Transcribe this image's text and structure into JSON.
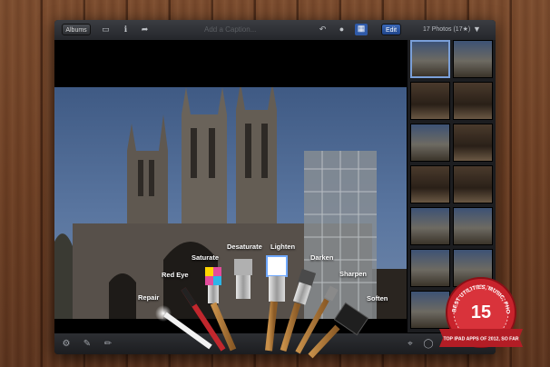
{
  "topbar": {
    "albums_label": "Albums",
    "caption_placeholder": "Add a Caption...",
    "edit_label": "Edit",
    "photo_count": "17 Photos (17★)"
  },
  "brushes": [
    {
      "label": "Repair",
      "color": "#ffffff"
    },
    {
      "label": "Red Eye",
      "color": "#c1272d"
    },
    {
      "label": "Saturate",
      "color": "#e24c9c"
    },
    {
      "label": "Desaturate",
      "color": "#b0b0b0"
    },
    {
      "label": "Lighten",
      "color": "#6fa8ff"
    },
    {
      "label": "Darken",
      "color": "#4a4a4a"
    },
    {
      "label": "Sharpen",
      "color": "#8a8a8a"
    },
    {
      "label": "Soften",
      "color": "#222222"
    }
  ],
  "badge": {
    "number": "15",
    "arc_text": "BEST UTILITIES, MUSIC, PHOTOS",
    "ribbon_text": "TOP IPAD APPS OF 2012, SO FAR"
  },
  "icons": {
    "bottom_left": [
      "gear-icon",
      "eraser-icon",
      "brush-toggle-icon"
    ],
    "bottom_right": [
      "crop-icon",
      "circle-icon",
      "undo-icon"
    ]
  },
  "colors": {
    "accent": "#2f5aa8",
    "badge_red": "#c8232c"
  }
}
